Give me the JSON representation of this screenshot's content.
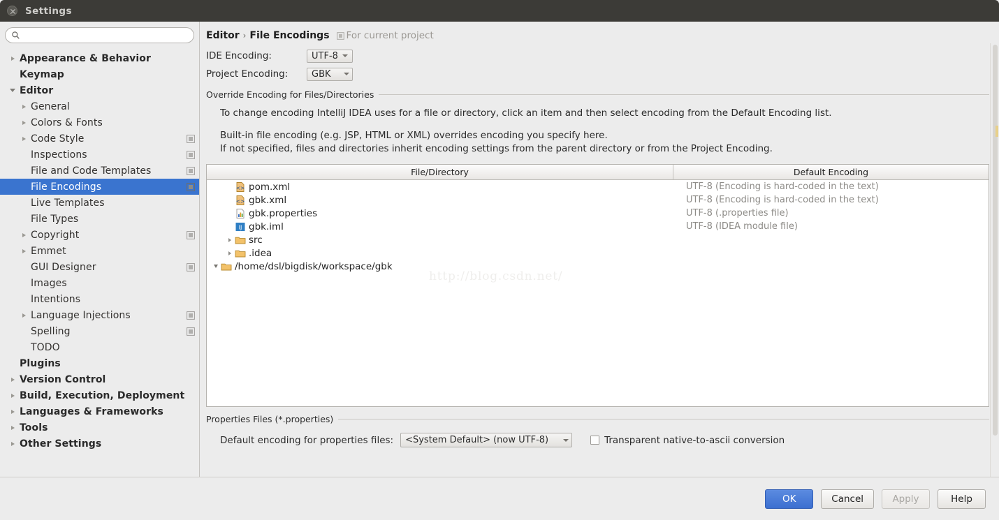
{
  "window": {
    "title": "Settings",
    "close_icon": "close-icon"
  },
  "search": {
    "placeholder": "",
    "value": "",
    "icon": "search-icon"
  },
  "sidebar": {
    "items": [
      {
        "label": "Appearance & Behavior",
        "level": 0,
        "arrow": "collapsed",
        "project_icon": false,
        "selected": false
      },
      {
        "label": "Keymap",
        "level": 0,
        "arrow": "none",
        "project_icon": false,
        "selected": false
      },
      {
        "label": "Editor",
        "level": 0,
        "arrow": "expanded",
        "project_icon": false,
        "selected": false
      },
      {
        "label": "General",
        "level": 1,
        "arrow": "collapsed",
        "project_icon": false,
        "selected": false
      },
      {
        "label": "Colors & Fonts",
        "level": 1,
        "arrow": "collapsed",
        "project_icon": false,
        "selected": false
      },
      {
        "label": "Code Style",
        "level": 1,
        "arrow": "collapsed",
        "project_icon": true,
        "selected": false
      },
      {
        "label": "Inspections",
        "level": 1,
        "arrow": "none",
        "project_icon": true,
        "selected": false
      },
      {
        "label": "File and Code Templates",
        "level": 1,
        "arrow": "none",
        "project_icon": true,
        "selected": false
      },
      {
        "label": "File Encodings",
        "level": 1,
        "arrow": "none",
        "project_icon": true,
        "selected": true
      },
      {
        "label": "Live Templates",
        "level": 1,
        "arrow": "none",
        "project_icon": false,
        "selected": false
      },
      {
        "label": "File Types",
        "level": 1,
        "arrow": "none",
        "project_icon": false,
        "selected": false
      },
      {
        "label": "Copyright",
        "level": 1,
        "arrow": "collapsed",
        "project_icon": true,
        "selected": false
      },
      {
        "label": "Emmet",
        "level": 1,
        "arrow": "collapsed",
        "project_icon": false,
        "selected": false
      },
      {
        "label": "GUI Designer",
        "level": 1,
        "arrow": "none",
        "project_icon": true,
        "selected": false
      },
      {
        "label": "Images",
        "level": 1,
        "arrow": "none",
        "project_icon": false,
        "selected": false
      },
      {
        "label": "Intentions",
        "level": 1,
        "arrow": "none",
        "project_icon": false,
        "selected": false
      },
      {
        "label": "Language Injections",
        "level": 1,
        "arrow": "collapsed",
        "project_icon": true,
        "selected": false
      },
      {
        "label": "Spelling",
        "level": 1,
        "arrow": "none",
        "project_icon": true,
        "selected": false
      },
      {
        "label": "TODO",
        "level": 1,
        "arrow": "none",
        "project_icon": false,
        "selected": false
      },
      {
        "label": "Plugins",
        "level": 0,
        "arrow": "none",
        "project_icon": false,
        "selected": false
      },
      {
        "label": "Version Control",
        "level": 0,
        "arrow": "collapsed",
        "project_icon": false,
        "selected": false
      },
      {
        "label": "Build, Execution, Deployment",
        "level": 0,
        "arrow": "collapsed",
        "project_icon": false,
        "selected": false
      },
      {
        "label": "Languages & Frameworks",
        "level": 0,
        "arrow": "collapsed",
        "project_icon": false,
        "selected": false
      },
      {
        "label": "Tools",
        "level": 0,
        "arrow": "collapsed",
        "project_icon": false,
        "selected": false
      },
      {
        "label": "Other Settings",
        "level": 0,
        "arrow": "collapsed",
        "project_icon": false,
        "selected": false
      }
    ]
  },
  "breadcrumb": {
    "parent": "Editor",
    "separator": "›",
    "current": "File Encodings",
    "note": "For current project",
    "note_icon": "project-scope-icon"
  },
  "encodings": {
    "ide_label": "IDE Encoding:",
    "ide_value": "UTF-8",
    "project_label": "Project Encoding:",
    "project_value": "GBK"
  },
  "override_group": {
    "title": "Override Encoding for Files/Directories",
    "line1": "To change encoding IntelliJ IDEA uses for a file or directory, click an item and then select encoding from the Default Encoding list.",
    "line2": "Built-in file encoding (e.g. JSP, HTML or XML) overrides encoding you specify here.",
    "line3": "If not specified, files and directories inherit encoding settings from the parent directory or from the Project Encoding."
  },
  "table": {
    "columns": [
      "File/Directory",
      "Default Encoding"
    ],
    "rows": [
      {
        "name": "/home/dsl/bigdisk/workspace/gbk",
        "indent": 0,
        "arrow": "expanded",
        "icon": "folder-icon",
        "encoding": ""
      },
      {
        "name": ".idea",
        "indent": 1,
        "arrow": "collapsed",
        "icon": "folder-icon",
        "encoding": ""
      },
      {
        "name": "src",
        "indent": 1,
        "arrow": "collapsed",
        "icon": "folder-icon",
        "encoding": ""
      },
      {
        "name": "gbk.iml",
        "indent": 1,
        "arrow": "none",
        "icon": "iml-module-icon",
        "encoding": "UTF-8 (IDEA module file)"
      },
      {
        "name": "gbk.properties",
        "indent": 1,
        "arrow": "none",
        "icon": "properties-file-icon",
        "encoding": "UTF-8 (.properties file)"
      },
      {
        "name": "gbk.xml",
        "indent": 1,
        "arrow": "none",
        "icon": "xml-file-icon",
        "encoding": "UTF-8 (Encoding is hard-coded in the text)"
      },
      {
        "name": "pom.xml",
        "indent": 1,
        "arrow": "none",
        "icon": "xml-file-icon",
        "encoding": "UTF-8 (Encoding is hard-coded in the text)"
      }
    ],
    "watermark": "http://blog.csdn.net/"
  },
  "properties_group": {
    "title": "Properties Files (*.properties)",
    "default_encoding_label": "Default encoding for properties files:",
    "default_encoding_value": "<System Default> (now UTF-8)",
    "checkbox_label": "Transparent native-to-ascii conversion",
    "checkbox_checked": false
  },
  "footer": {
    "ok": "OK",
    "cancel": "Cancel",
    "apply": "Apply",
    "apply_disabled": true,
    "help": "Help"
  },
  "colors": {
    "selection": "#3a74cf",
    "primary_button": "#3c6fd0",
    "titlebar": "#3c3b37",
    "window_bg": "#ececec"
  }
}
